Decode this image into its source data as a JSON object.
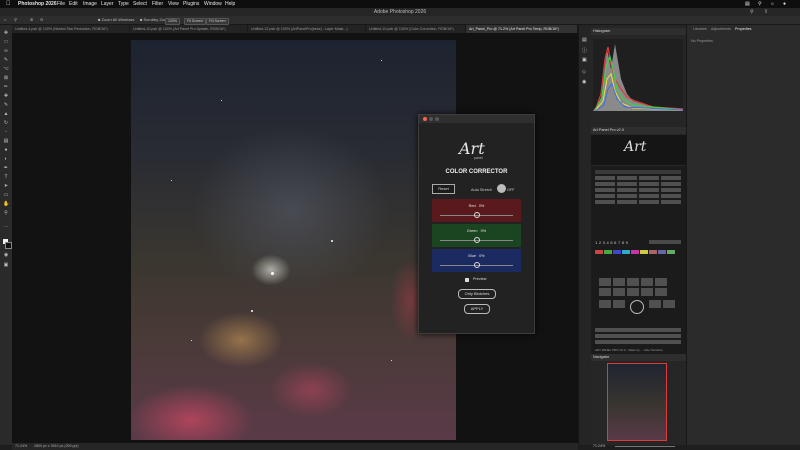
{
  "menubar": {
    "app_name": "Photoshop 2026",
    "items": [
      "File",
      "Edit",
      "Image",
      "Layer",
      "Type",
      "Select",
      "Filter",
      "View",
      "Plugins",
      "Window",
      "Help"
    ]
  },
  "window": {
    "title": "Adobe Photoshop 2026"
  },
  "options_bar": {
    "zoom_all_windows": "Zoom All Windows",
    "scrubby_zoom": "Scrubby Zoom",
    "zoom_percent": "100%",
    "fit_screen": "Fit Screen",
    "fill_screen": "Fill Screen"
  },
  "tabs": [
    {
      "label": "Untitled-4.psb @ 100% (Nested Star Reduction, RGB/16*)",
      "active": false
    },
    {
      "label": "Untitled-10.psb @ 100% (Art Panel Pro Update, RGB/16*)",
      "active": false
    },
    {
      "label": "Untitled-12.psb @ 100% (ArtPanelPro(bese)...Layer Mask...)",
      "active": false
    },
    {
      "label": "Untitled-10.psb @ 100% (Color Correction, RGB/16*)",
      "active": false
    },
    {
      "label": "Art_Panel_Pro @ 71.2% (Art Panel Pro Temp, RGB/16*)",
      "active": true
    }
  ],
  "status_bar": {
    "zoom": "71.24%",
    "doc_info": "2800 px x 3510 px (300 ppi)"
  },
  "dialog": {
    "logo_text": "Art",
    "logo_sub": "panel",
    "heading": "COLOR CORRECTOR",
    "reset_label": "Reset",
    "auto_stretch_label": "Auto Stretch",
    "toggle_state": "OFF",
    "sliders": [
      {
        "label": "Red",
        "value": "0%",
        "color": "#6a1c1f"
      },
      {
        "label": "Green",
        "value": "0%",
        "color": "#1f4a22"
      },
      {
        "label": "Blue",
        "value": "0%",
        "color": "#1f2e6a"
      }
    ],
    "preview_label": "Preview",
    "only_blotches_label": "Only Blotches",
    "apply_label": "APPLY"
  },
  "histogram_panel": {
    "title": "Histogram"
  },
  "art_panel": {
    "title": "Art Panel Pro v2.0",
    "logo_text": "Art",
    "numbers": [
      "1",
      "2",
      "3",
      "4",
      "5",
      "6",
      "7",
      "8",
      "9",
      "10",
      "11",
      "12"
    ],
    "footer": "ART PANEL PRO V2.0   ·   Made by ...   Aide Nocturne"
  },
  "navigator": {
    "title": "Navigator",
    "zoom": "71.24%"
  },
  "properties_panel": {
    "tabs": [
      "Libraries",
      "Adjustments",
      "Properties"
    ],
    "active_tab": "Properties",
    "content": "No Properties"
  }
}
